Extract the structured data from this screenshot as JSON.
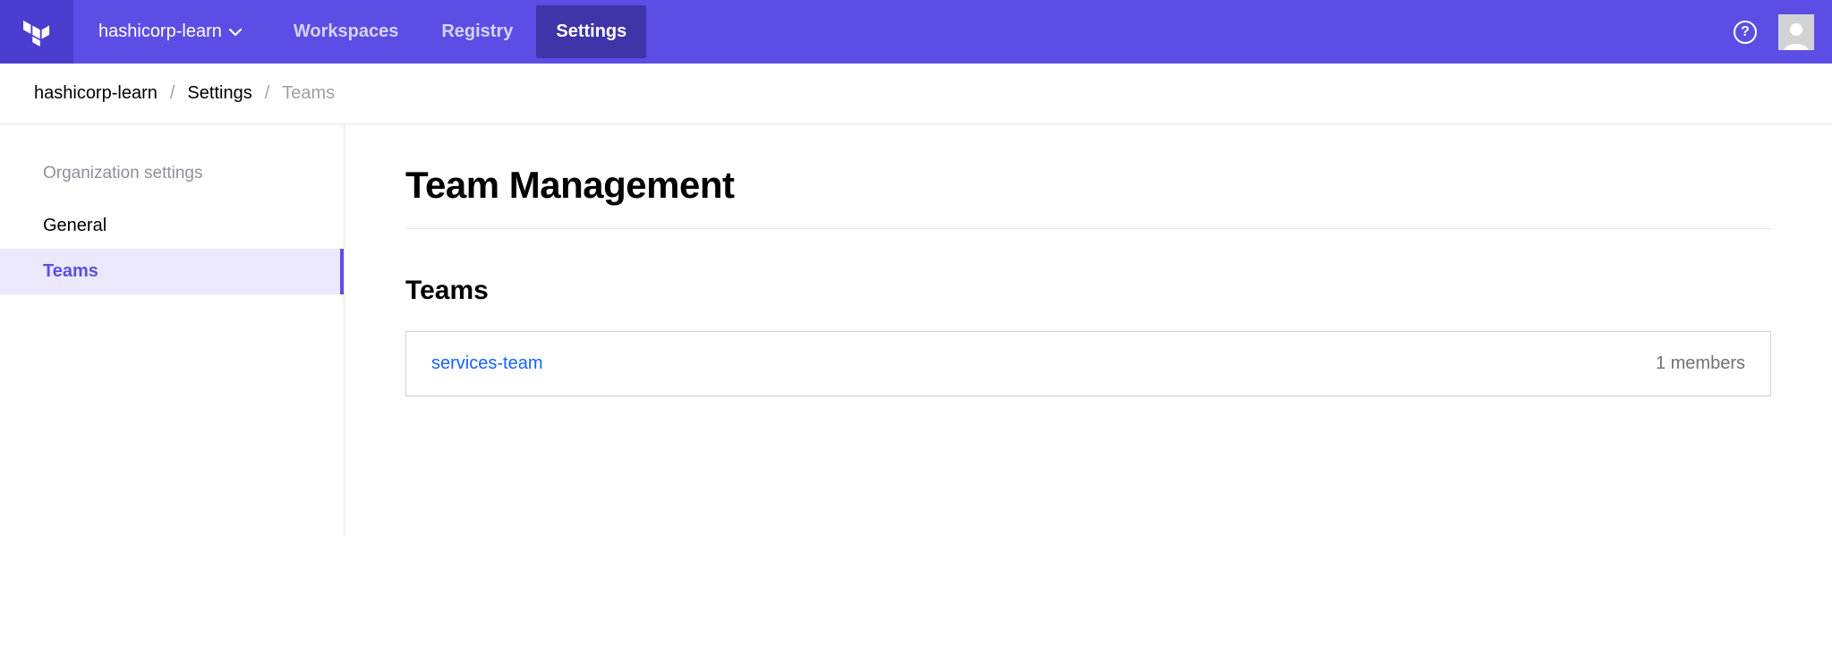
{
  "org": {
    "name": "hashicorp-learn"
  },
  "nav": {
    "workspaces": "Workspaces",
    "registry": "Registry",
    "settings": "Settings"
  },
  "breadcrumb": {
    "org": "hashicorp-learn",
    "settings": "Settings",
    "current": "Teams"
  },
  "sidebar": {
    "heading": "Organization settings",
    "items": [
      {
        "label": "General"
      },
      {
        "label": "Teams"
      }
    ]
  },
  "main": {
    "title": "Team Management",
    "teams_heading": "Teams",
    "teams": [
      {
        "name": "services-team",
        "members_text": "1 members"
      }
    ]
  }
}
